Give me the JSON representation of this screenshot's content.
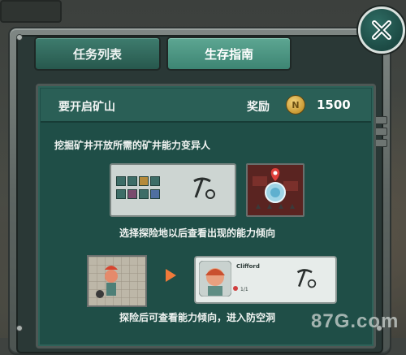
{
  "tabs": [
    {
      "label": "任务列表"
    },
    {
      "label": "生存指南"
    }
  ],
  "close_button": {
    "icon": "close-x-icon"
  },
  "mission": {
    "title": "要开启矿山",
    "reward_label": "奖励",
    "reward_amount": "1500",
    "coin_icon": "coin-icon"
  },
  "guide": {
    "line1": "挖掘矿井开放所需的矿井能力变异人",
    "line2": "选择探险地以后查看出现的能力倾向",
    "line3": "探险后可查看能力倾向，进入防空洞"
  },
  "card": {
    "name": "Clifford",
    "count": "1/1"
  },
  "watermark": "87G.com",
  "colors": {
    "panel": "#1f4e47",
    "tab_active": "#4f9a86",
    "arrow": "#f07a3a"
  }
}
